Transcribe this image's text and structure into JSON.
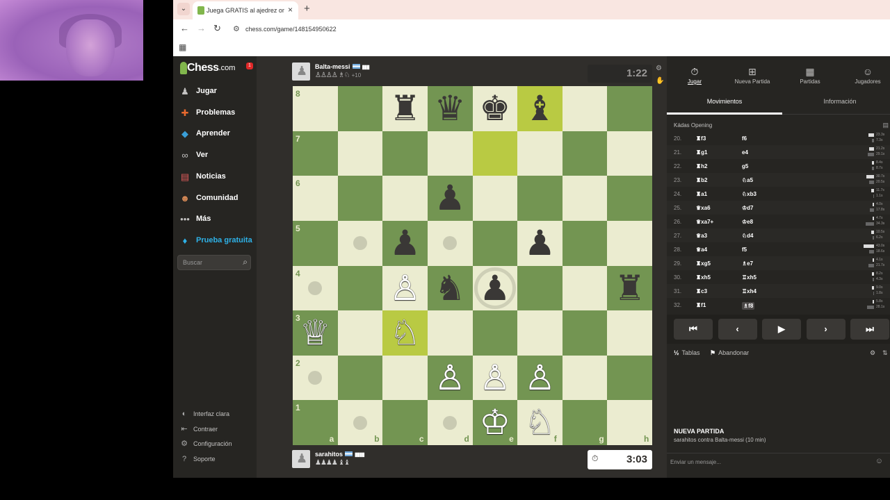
{
  "browser": {
    "tab_title": "Juega GRATIS al ajedrez online",
    "url": "chess.com/game/148154950622"
  },
  "sidebar": {
    "logo_text": "Chess",
    "logo_domain": ".com",
    "notification_count": "1",
    "items": [
      {
        "label": "Jugar",
        "icon": "play-pawn-icon",
        "color": "#c3c2c1"
      },
      {
        "label": "Problemas",
        "icon": "puzzle-icon",
        "color": "#e8692e"
      },
      {
        "label": "Aprender",
        "icon": "learn-icon",
        "color": "#3a9fd8"
      },
      {
        "label": "Ver",
        "icon": "binoculars-icon",
        "color": "#c3c2c1"
      },
      {
        "label": "Noticias",
        "icon": "news-icon",
        "color": "#e05b5b"
      },
      {
        "label": "Comunidad",
        "icon": "community-icon",
        "color": "#d98b57"
      },
      {
        "label": "Más",
        "icon": "more-icon",
        "color": "#c3c2c1"
      },
      {
        "label": "Prueba gratuita",
        "icon": "diamond-icon",
        "color": "#2eb2e8"
      }
    ],
    "search_placeholder": "Buscar",
    "footer": [
      {
        "label": "Interfaz clara",
        "icon": "theme-icon"
      },
      {
        "label": "Contraer",
        "icon": "collapse-icon"
      },
      {
        "label": "Configuración",
        "icon": "settings-icon"
      },
      {
        "label": "Soporte",
        "icon": "support-icon"
      }
    ]
  },
  "game": {
    "top_player": {
      "name": "Balta-messi",
      "captured": "♙♙♙♙ ♗♘",
      "advantage": "+10"
    },
    "bottom_player": {
      "name": "sarahitos",
      "captured": "♟♟♟♟ ♝♝"
    },
    "top_clock": "1:22",
    "bottom_clock": "3:03",
    "files": [
      "a",
      "b",
      "c",
      "d",
      "e",
      "f",
      "g",
      "h"
    ],
    "ranks": [
      "8",
      "7",
      "6",
      "5",
      "4",
      "3",
      "2",
      "1"
    ],
    "pieces": [
      {
        "sq": "c8",
        "p": "♜",
        "side": "b"
      },
      {
        "sq": "d8",
        "p": "♛",
        "side": "b"
      },
      {
        "sq": "e8",
        "p": "♚",
        "side": "b"
      },
      {
        "sq": "f8",
        "p": "♝",
        "side": "b"
      },
      {
        "sq": "d6",
        "p": "♟",
        "side": "b"
      },
      {
        "sq": "c5",
        "p": "♟",
        "side": "b"
      },
      {
        "sq": "f5",
        "p": "♟",
        "side": "b"
      },
      {
        "sq": "d4",
        "p": "♞",
        "side": "b"
      },
      {
        "sq": "e4",
        "p": "♟",
        "side": "b"
      },
      {
        "sq": "h4",
        "p": "♜",
        "side": "b"
      },
      {
        "sq": "c4",
        "p": "♙",
        "side": "w"
      },
      {
        "sq": "a3",
        "p": "♕",
        "side": "w"
      },
      {
        "sq": "c3",
        "p": "♘",
        "side": "w"
      },
      {
        "sq": "d2",
        "p": "♙",
        "side": "w"
      },
      {
        "sq": "e2",
        "p": "♙",
        "side": "w"
      },
      {
        "sq": "f2",
        "p": "♙",
        "side": "w"
      },
      {
        "sq": "e1",
        "p": "♔",
        "side": "w"
      },
      {
        "sq": "f1",
        "p": "♘",
        "side": "w"
      }
    ],
    "highlights": [
      "f8",
      "e7",
      "c3"
    ],
    "move_hints": [
      "b5",
      "d5",
      "a4",
      "a2",
      "b1",
      "d1"
    ],
    "capture_hints": [
      "e4"
    ]
  },
  "panel": {
    "tabs": [
      {
        "label": "Jugar",
        "icon": "stopwatch-icon"
      },
      {
        "label": "Nueva Partida",
        "icon": "new-game-icon"
      },
      {
        "label": "Partidas",
        "icon": "games-icon"
      },
      {
        "label": "Jugadores",
        "icon": "players-icon"
      }
    ],
    "subtabs": [
      "Movimientos",
      "Información"
    ],
    "opening": "Kádas Opening",
    "moves": [
      {
        "n": "20.",
        "w": "♜f3",
        "b": "f6",
        "t1": "23.3s",
        "t2": "7.3s",
        "b1": 8,
        "b2": 3
      },
      {
        "n": "21.",
        "w": "♜g1",
        "b": "e4",
        "t1": "21.2s",
        "t2": "29.1s",
        "b1": 7,
        "b2": 9
      },
      {
        "n": "22.",
        "w": "♜h2",
        "b": "g5",
        "t1": "8.4s",
        "t2": "8.7s",
        "b1": 3,
        "b2": 3
      },
      {
        "n": "23.",
        "w": "♜b2",
        "b": "♘a5",
        "t1": "30.7s",
        "t2": "20.5s",
        "b1": 11,
        "b2": 7
      },
      {
        "n": "24.",
        "w": "♜a1",
        "b": "♘xb3",
        "t1": "11.7s",
        "t2": "1.1s",
        "b1": 4,
        "b2": 1
      },
      {
        "n": "25.",
        "w": "♛xa6",
        "b": "♔d7",
        "t1": "4.0s",
        "t2": "17.8s",
        "b1": 2,
        "b2": 6
      },
      {
        "n": "26.",
        "w": "♛xa7+",
        "b": "♔e8",
        "t1": "4.7s",
        "t2": "34.3s",
        "b1": 2,
        "b2": 12
      },
      {
        "n": "27.",
        "w": "♛a3",
        "b": "♘d4",
        "t1": "10.5s",
        "t2": "6.2s",
        "b1": 4,
        "b2": 2
      },
      {
        "n": "28.",
        "w": "♛a4",
        "b": "f5",
        "t1": "43.0s",
        "t2": "18.6s",
        "b1": 15,
        "b2": 7
      },
      {
        "n": "29.",
        "w": "♜xg5",
        "b": "♗e7",
        "t1": "4.1s",
        "t2": "21.7s",
        "b1": 2,
        "b2": 8
      },
      {
        "n": "30.",
        "w": "♜xh5",
        "b": "♖xh5",
        "t1": "8.2s",
        "t2": "4.3s",
        "b1": 3,
        "b2": 2
      },
      {
        "n": "31.",
        "w": "♜c3",
        "b": "♖xh4",
        "t1": "9.0s",
        "t2": "1.8s",
        "b1": 3,
        "b2": 1
      },
      {
        "n": "32.",
        "w": "♜f1",
        "b": "♗f8",
        "t1": "5.8s",
        "t2": "28.1s",
        "b1": 2,
        "b2": 10
      }
    ],
    "controls": [
      "⏮",
      "‹",
      "▶",
      "›",
      "⏭"
    ],
    "draw_label": "Tablas",
    "resign_label": "Abandonar",
    "new_game_heading": "NUEVA PARTIDA",
    "new_game_desc": "sarahitos contra Balta-messi (10 min)",
    "chat_placeholder": "Enviar un mensaje..."
  },
  "colors": {
    "light_square": "#ebecd0",
    "dark_square": "#739552",
    "highlight": "#b9ca43",
    "accent_green": "#81b64c"
  }
}
